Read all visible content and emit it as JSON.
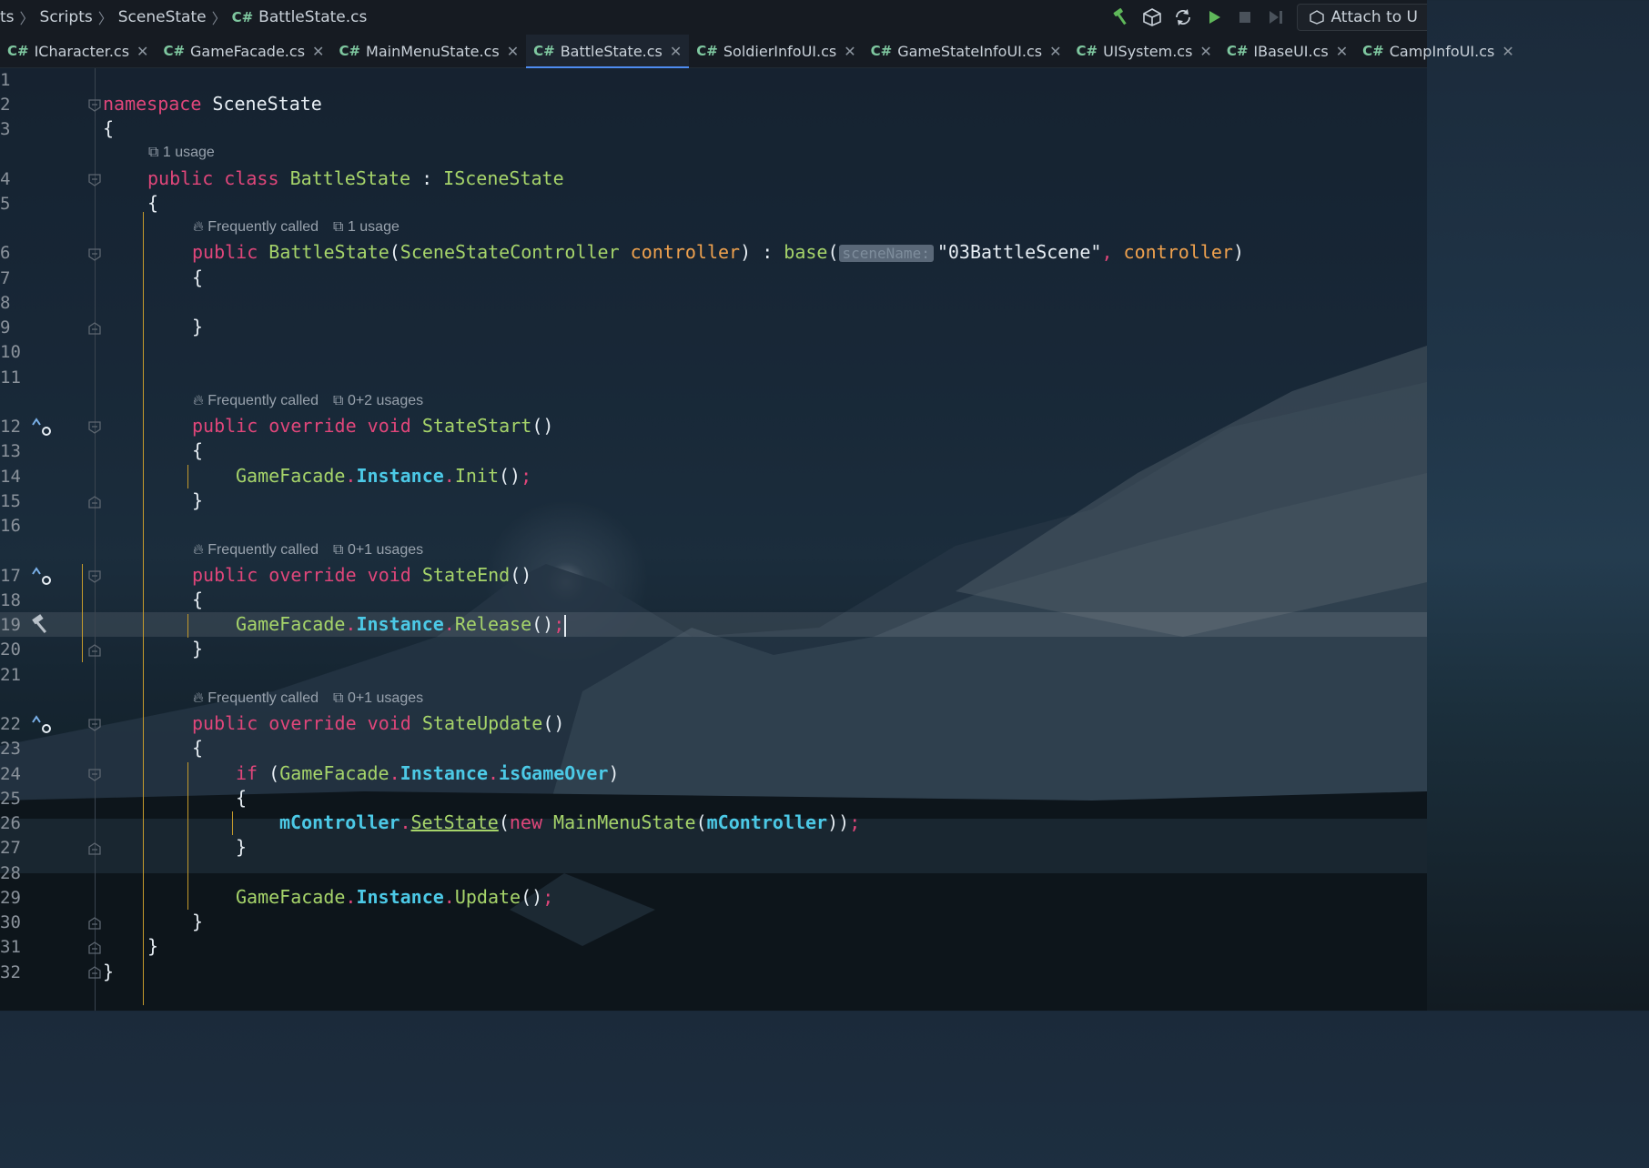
{
  "breadcrumb": {
    "items": [
      "ts",
      "Scripts",
      "SceneState"
    ],
    "file_lang": "C#",
    "file": "BattleState.cs"
  },
  "toolbar": {
    "attach_label": "Attach to U",
    "icons": [
      "hammer-icon",
      "unity-icon",
      "refresh-icon",
      "play-icon",
      "stop-icon",
      "step-icon"
    ]
  },
  "tabs": [
    {
      "lang": "C#",
      "label": "ICharacter.cs",
      "active": false
    },
    {
      "lang": "C#",
      "label": "GameFacade.cs",
      "active": false
    },
    {
      "lang": "C#",
      "label": "MainMenuState.cs",
      "active": false
    },
    {
      "lang": "C#",
      "label": "BattleState.cs",
      "active": true
    },
    {
      "lang": "C#",
      "label": "SoldierInfoUI.cs",
      "active": false
    },
    {
      "lang": "C#",
      "label": "GameStateInfoUI.cs",
      "active": false
    },
    {
      "lang": "C#",
      "label": "UISystem.cs",
      "active": false
    },
    {
      "lang": "C#",
      "label": "IBaseUI.cs",
      "active": false
    },
    {
      "lang": "C#",
      "label": "CampInfoUI.cs",
      "active": false
    }
  ],
  "hints": {
    "class_usage": "1 usage",
    "freq": "Frequently called",
    "ctor_usage": "1 usage",
    "start_usage": "0+2 usages",
    "end_usage": "0+1 usages",
    "update_usage": "0+1 usages"
  },
  "code": {
    "kw_namespace": "namespace",
    "ns_name": "SceneState",
    "kw_public": "public",
    "kw_class": "class",
    "class_name": "BattleState",
    "base_iface": "ISceneState",
    "ctor_type": "SceneStateController",
    "ctor_param": "controller",
    "kw_base": "base",
    "inlay_param": "sceneName:",
    "scene_string": "\"03BattleScene\"",
    "kw_override": "override",
    "kw_void": "void",
    "m_start": "StateStart",
    "m_end": "StateEnd",
    "m_update": "StateUpdate",
    "facade": "GameFacade",
    "instance": "Instance",
    "init": "Init",
    "release": "Release",
    "kw_if": "if",
    "is_game_over": "isGameOver",
    "m_controller": "mController",
    "set_state": "SetState",
    "kw_new": "new",
    "menu_state": "MainMenuState",
    "update": "Update"
  },
  "line_numbers": [
    "1",
    "2",
    "3",
    "4",
    "5",
    "6",
    "7",
    "8",
    "9",
    "10",
    "11",
    "12",
    "13",
    "14",
    "15",
    "16",
    "17",
    "18",
    "19",
    "20",
    "21",
    "22",
    "23",
    "24",
    "25",
    "26",
    "27",
    "28",
    "29",
    "30",
    "31",
    "32"
  ]
}
